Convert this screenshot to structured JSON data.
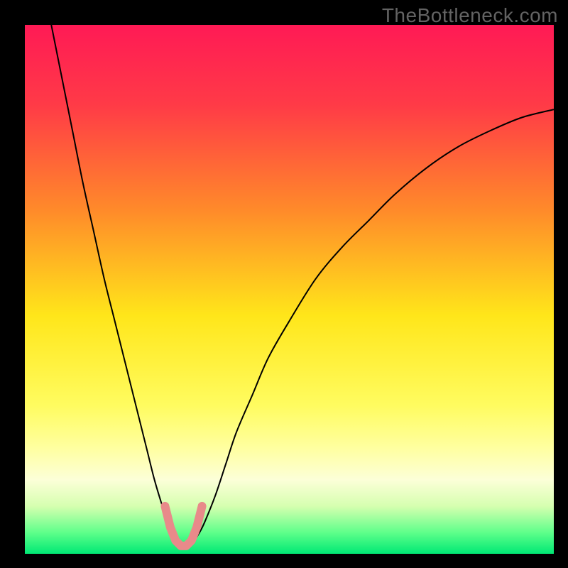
{
  "watermark": "TheBottleneck.com",
  "chart_data": {
    "type": "line",
    "title": "",
    "xlabel": "",
    "ylabel": "",
    "xlim": [
      0,
      100
    ],
    "ylim": [
      0,
      100
    ],
    "grid": false,
    "background_gradient": {
      "type": "vertical",
      "stops": [
        {
          "offset": 0.0,
          "color": "#ff1a55"
        },
        {
          "offset": 0.15,
          "color": "#ff3a47"
        },
        {
          "offset": 0.35,
          "color": "#ff8a2a"
        },
        {
          "offset": 0.55,
          "color": "#ffe61a"
        },
        {
          "offset": 0.72,
          "color": "#fffc60"
        },
        {
          "offset": 0.8,
          "color": "#ffffa0"
        },
        {
          "offset": 0.86,
          "color": "#fcffd8"
        },
        {
          "offset": 0.91,
          "color": "#d6ffb0"
        },
        {
          "offset": 0.96,
          "color": "#5eff8a"
        },
        {
          "offset": 1.0,
          "color": "#00e874"
        }
      ]
    },
    "series": [
      {
        "name": "curve",
        "stroke": "#000000",
        "stroke_width": 2,
        "x": [
          5,
          7,
          9,
          11,
          13,
          15,
          17,
          19,
          21,
          23,
          24.5,
          26,
          27,
          28,
          29,
          30,
          31,
          32,
          33,
          34,
          36,
          38,
          40,
          43,
          46,
          50,
          55,
          60,
          65,
          70,
          76,
          82,
          88,
          94,
          100
        ],
        "y": [
          100,
          90,
          80,
          70,
          61,
          52,
          44,
          36,
          28,
          20,
          14,
          9,
          6,
          4,
          2.5,
          1.5,
          1.5,
          2.5,
          4,
          6,
          11,
          17,
          23,
          30,
          37,
          44,
          52,
          58,
          63,
          68,
          73,
          77,
          80,
          82.5,
          84
        ]
      },
      {
        "name": "marker-cluster",
        "stroke": "#e88a8a",
        "stroke_width": 12,
        "linecap": "round",
        "x": [
          26.5,
          27.5,
          28.5,
          29.5,
          30.5,
          31.5,
          32.5,
          33.5
        ],
        "y": [
          9,
          5,
          2.5,
          1.5,
          1.5,
          2.5,
          5,
          9
        ]
      }
    ]
  }
}
